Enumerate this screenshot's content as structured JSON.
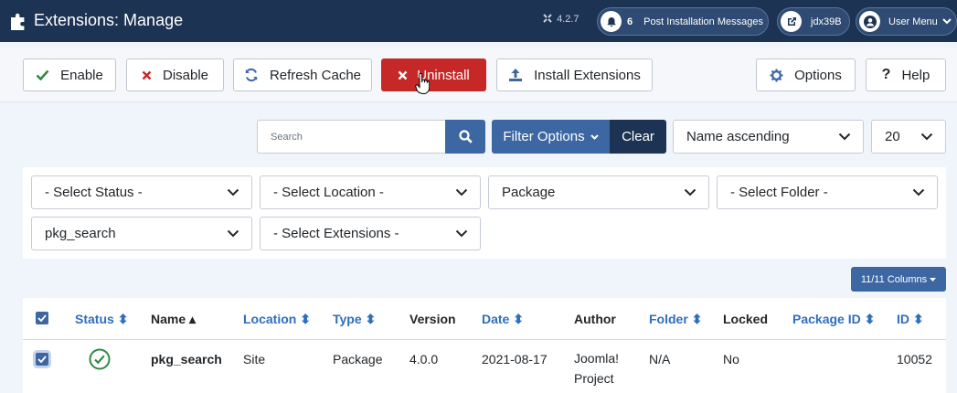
{
  "header": {
    "title": "Extensions: Manage",
    "version": "4.2.7",
    "notifications": {
      "count": "6",
      "label": "Post Installation Messages"
    },
    "site_link": "jdx39B",
    "user_menu": "User Menu"
  },
  "toolbar": {
    "enable": "Enable",
    "disable": "Disable",
    "refresh": "Refresh Cache",
    "uninstall": "Uninstall",
    "install": "Install Extensions",
    "options": "Options",
    "help": "Help"
  },
  "search": {
    "placeholder": "Search",
    "filter_options": "Filter Options",
    "clear": "Clear",
    "ordering": "Name ascending",
    "limit": "20"
  },
  "filters": {
    "status": "- Select Status -",
    "location": "- Select Location -",
    "type": "Package",
    "folder": "- Select Folder -",
    "core": "pkg_search",
    "extensions": "- Select Extensions -"
  },
  "columns_button": "11/11 Columns",
  "table": {
    "headers": {
      "status": "Status",
      "name": "Name",
      "location": "Location",
      "type": "Type",
      "version": "Version",
      "date": "Date",
      "author": "Author",
      "folder": "Folder",
      "locked": "Locked",
      "package_id": "Package ID",
      "id": "ID"
    },
    "rows": [
      {
        "name": "pkg_search",
        "location": "Site",
        "type": "Package",
        "version": "4.0.0",
        "date": "2021-08-17",
        "author_line1": "Joomla!",
        "author_line2": "Project",
        "folder": "N/A",
        "locked": "No",
        "package_id": "",
        "id": "10052"
      }
    ]
  },
  "colors": {
    "header_bg": "#1c3353",
    "primary": "#3d67a2",
    "danger": "#c52827",
    "link": "#2f6dbd",
    "success": "#2e8a45"
  }
}
